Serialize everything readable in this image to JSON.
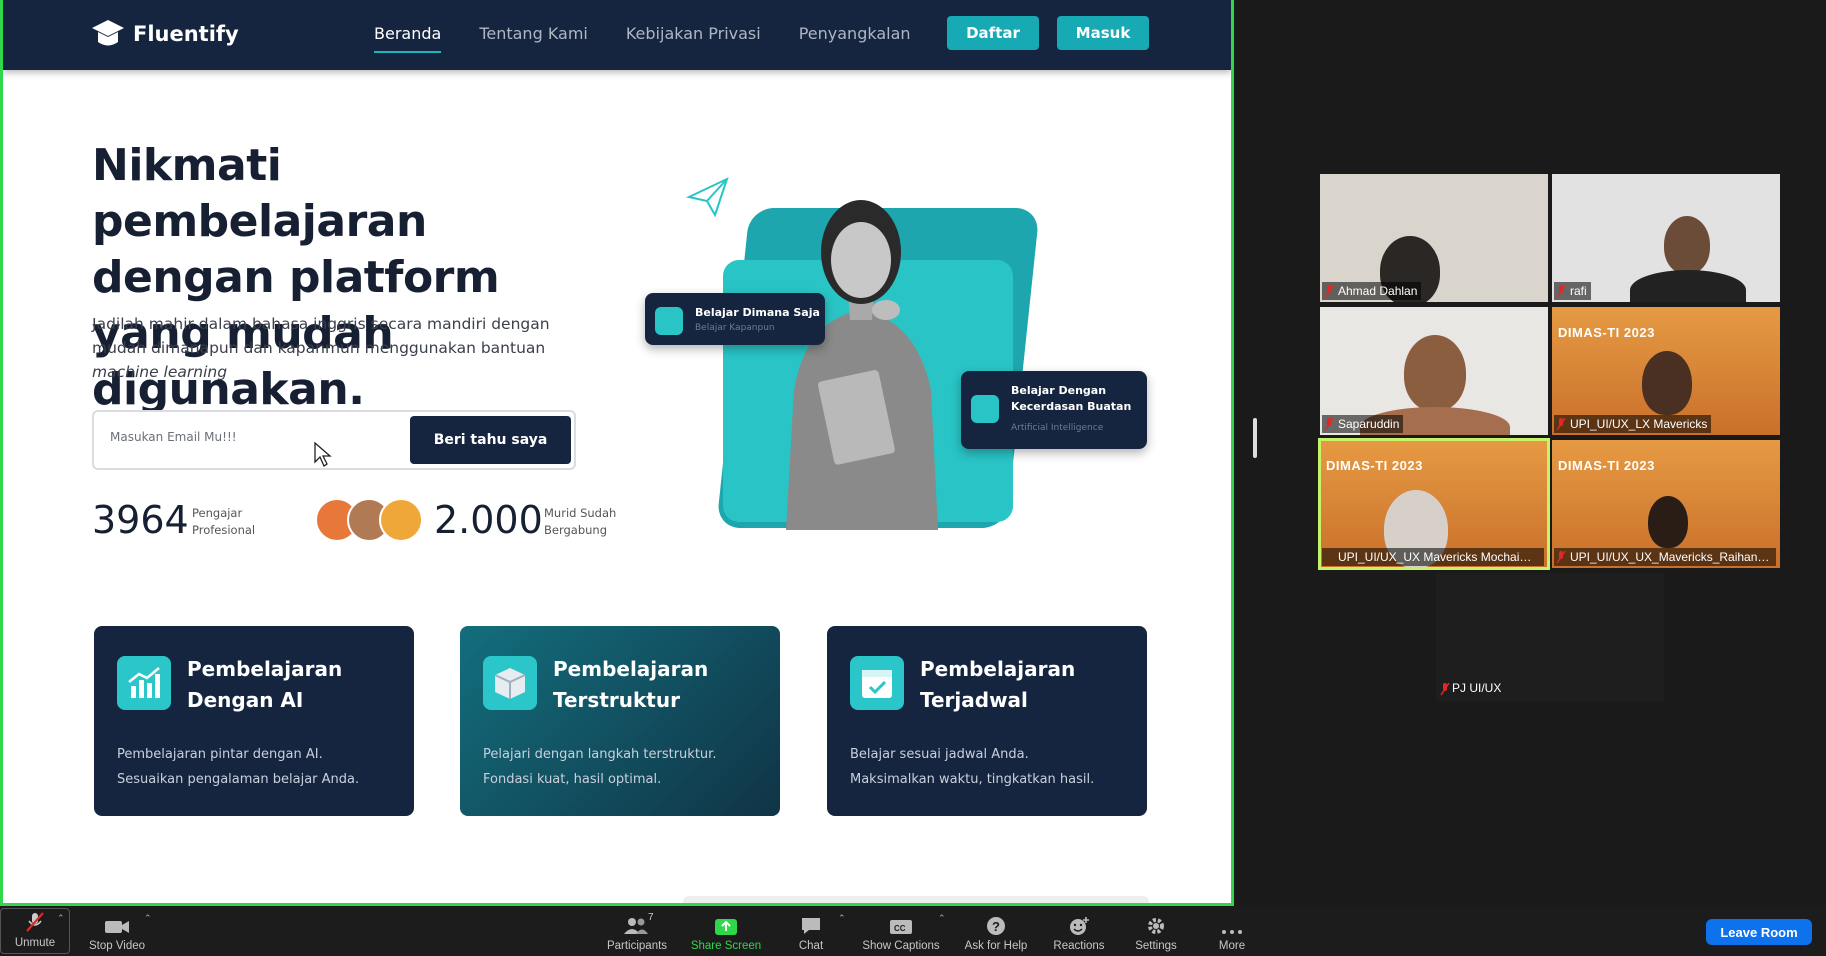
{
  "website": {
    "brand": "Fluentify",
    "nav": [
      {
        "label": "Beranda"
      },
      {
        "label": "Tentang Kami"
      },
      {
        "label": "Kebijakan Privasi"
      },
      {
        "label": "Penyangkalan"
      }
    ],
    "btn_daftar": "Daftar",
    "btn_masuk": "Masuk",
    "hero_title": "Nikmati pembelajaran dengan platform yang mudah digunakan.",
    "hero_desc_1": "Jadilah mahir dalam bahasa inggris secara mandiri dengan mudah dimanapun dan kapanmun menggunakan bantuan ",
    "hero_desc_em": "machine learning",
    "email_placeholder": "Masukan Email Mu!!!",
    "email_button": "Beri tahu saya",
    "stat1_num": "3964",
    "stat1_label_1": "Pengajar",
    "stat1_label_2": "Profesional",
    "stat2_num": "2.000",
    "stat2_label_1": "Murid Sudah",
    "stat2_label_2": "Bergabung",
    "float1_title": "Belajar Dimana Saja",
    "float1_sub": "Belajar Kapanpun",
    "float2_title_1": "Belajar Dengan",
    "float2_title_2": "Kecerdasan Buatan",
    "float2_sub": "Artificial Intelligence",
    "features": [
      {
        "t1": "Pembelajaran",
        "t2": "Dengan AI",
        "d1": "Pembelajaran pintar dengan AI.",
        "d2": "Sesuaikan pengalaman belajar Anda.",
        "icon": "chart-icon"
      },
      {
        "t1": "Pembelajaran",
        "t2": "Terstruktur",
        "d1": "Pelajari dengan langkah terstruktur.",
        "d2": "Fondasi kuat, hasil optimal.",
        "icon": "box-icon"
      },
      {
        "t1": "Pembelajaran",
        "t2": "Terjadwal",
        "d1": "Belajar sesuai jadwal Anda.",
        "d2": "Maksimalkan waktu, tingkatkan hasil.",
        "icon": "calendar-icon"
      }
    ]
  },
  "participants": [
    {
      "name": "Ahmad Dahlan"
    },
    {
      "name": "rafi"
    },
    {
      "name": "Saparuddin"
    },
    {
      "name": "UPI_UI/UX_LX Mavericks"
    },
    {
      "name": "UPI_UI/UX_UX Mavericks Mochaimin M..."
    },
    {
      "name": "UPI_UI/UX_UX_Mavericks_Raihan Sy..."
    },
    {
      "name": "PJ UI/UX"
    }
  ],
  "banner_text": "DIMAS-TI 2023",
  "toolbar": {
    "unmute": "Unmute",
    "stop_video": "Stop Video",
    "participants": "Participants",
    "participants_count": "7",
    "share_screen": "Share Screen",
    "chat": "Chat",
    "show_captions": "Show Captions",
    "ask_help": "Ask for Help",
    "reactions": "Reactions",
    "settings": "Settings",
    "more": "More",
    "leave": "Leave Room"
  },
  "colors": {
    "navy": "#16253f",
    "teal": "#17a9b4",
    "zoom_blue": "#0e72ed",
    "active_speaker": "#c7f36b",
    "share_border": "#2fd84a"
  }
}
